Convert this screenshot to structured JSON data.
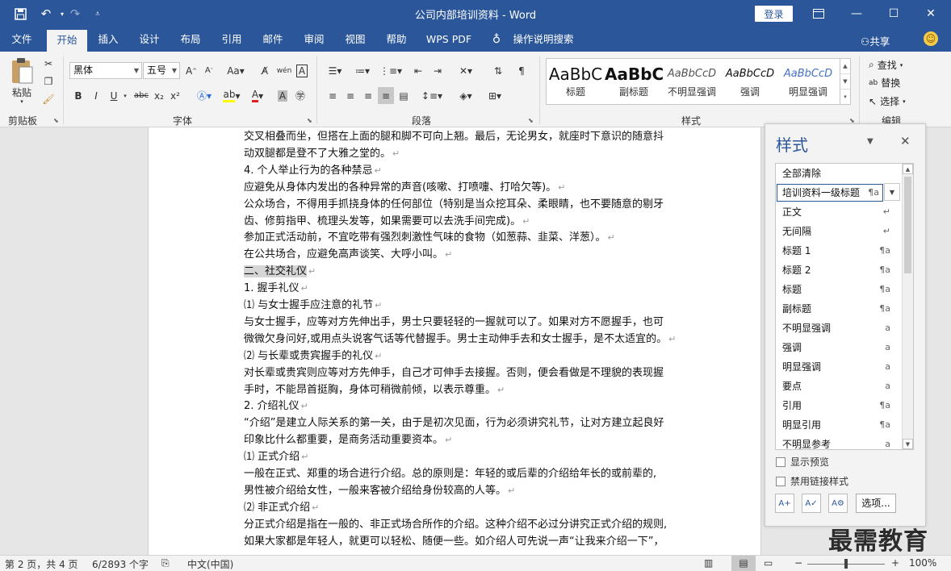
{
  "app": {
    "window_title": "公司内部培训资料  -  Word",
    "login_label": "登录",
    "quick_access": {
      "save": "save-icon",
      "undo": "undo-icon",
      "redo": "redo-icon",
      "customize": "customize-icon"
    },
    "window_controls": {
      "ribbon_display": "ribbon-display-icon",
      "minimize": "—",
      "maximize": "☐",
      "close": "✕"
    }
  },
  "tabs": [
    "文件",
    "开始",
    "插入",
    "设计",
    "布局",
    "引用",
    "邮件",
    "审阅",
    "视图",
    "帮助",
    "WPS PDF",
    "操作说明搜索"
  ],
  "active_tab": "开始",
  "share_label": "共享",
  "ribbon": {
    "clipboard": {
      "paste": "粘贴",
      "label": "剪贴板"
    },
    "font": {
      "name": "黑体",
      "size": "五号",
      "label": "字体",
      "buttons": [
        "B",
        "I",
        "U",
        "abc",
        "x₂",
        "x²"
      ]
    },
    "paragraph": {
      "label": "段落"
    },
    "styles": {
      "label": "样式",
      "gallery": [
        {
          "sample": "AaBbC",
          "name": "标题"
        },
        {
          "sample": "AaBbC",
          "name": "副标题"
        },
        {
          "sample": "AaBbCcD",
          "name": "不明显强调"
        },
        {
          "sample": "AaBbCcD",
          "name": "强调"
        },
        {
          "sample": "AaBbCcD",
          "name": "明显强调"
        }
      ]
    },
    "editing": {
      "find": "查找",
      "replace": "替换",
      "select": "选择",
      "label": "编辑"
    }
  },
  "document": {
    "lines": [
      {
        "text": "交叉相叠而坐，但搭在上面的腿和脚不可向上翘。最后，无论男女，就座时下意识的随意抖",
        "pm": ""
      },
      {
        "text": "动双腿都是登不了大雅之堂的。",
        "pm": "↵"
      },
      {
        "text": "4. 个人举止行为的各种禁忌",
        "pm": "↵"
      },
      {
        "text": "应避免从身体内发出的各种异常的声音(咳嗽、打喷嚏、打哈欠等)。",
        "pm": "↵"
      },
      {
        "text": "公众场合，不得用手抓挠身体的任何部位（特别是当众挖耳朵、柔眼睛，也不要随意的剔牙",
        "pm": ""
      },
      {
        "text": "齿、修剪指甲、梳理头发等，如果需要可以去洗手间完成)。",
        "pm": "↵"
      },
      {
        "text": "参加正式活动前，不宜吃带有强烈刺激性气味的食物（如葱蒜、韭菜、洋葱）。",
        "pm": "↵"
      },
      {
        "text": "在公共场合，应避免高声谈笑、大呼小叫。",
        "pm": "↵"
      },
      {
        "text": "二、社交礼仪",
        "pm": "↵",
        "highlight": true
      },
      {
        "text": "1. 握手礼仪",
        "pm": "↵"
      },
      {
        "text": "⑴ 与女士握手应注意的礼节",
        "pm": "↵"
      },
      {
        "text": "与女士握手，应等对方先伸出手，男士只要轻轻的一握就可以了。如果对方不愿握手，也可",
        "pm": ""
      },
      {
        "text": "微微欠身问好,或用点头说客气话等代替握手。男士主动伸手去和女士握手，是不太适宜的。",
        "pm": "↵"
      },
      {
        "text": "⑵ 与长辈或贵宾握手的礼仪",
        "pm": "↵"
      },
      {
        "text": "对长辈或贵宾则应等对方先伸手，自己才可伸手去接握。否则，便会看做是不理貌的表现握",
        "pm": ""
      },
      {
        "text": "手时，不能昂首挺胸，身体可稍微前倾，以表示尊重。",
        "pm": "↵"
      },
      {
        "text": "2. 介绍礼仪",
        "pm": "↵"
      },
      {
        "text": "“介绍”是建立人际关系的第一关，由于是初次见面，行为必须讲究礼节，让对方建立起良好",
        "pm": ""
      },
      {
        "text": "印象比什么都重要，是商务活动重要资本。",
        "pm": "↵"
      },
      {
        "text": "⑴ 正式介绍",
        "pm": "↵"
      },
      {
        "text": "一般在正式、郑重的场合进行介绍。总的原则是：年轻的或后辈的介绍给年长的或前辈的,",
        "pm": ""
      },
      {
        "text": "男性被介绍给女性，一般来客被介绍给身份较高的人等。",
        "pm": "↵"
      },
      {
        "text": "⑵ 非正式介绍",
        "pm": "↵"
      },
      {
        "text": "分正式介绍是指在一般的、非正式场合所作的介绍。这种介绍不必过分讲究正式介绍的规则,",
        "pm": ""
      },
      {
        "text": "如果大家都是年轻人，就更可以轻松、随便一些。如介绍人可先说一声“让我来介绍一下”，",
        "pm": ""
      }
    ]
  },
  "styles_pane": {
    "title": "样式",
    "items": [
      {
        "name": "全部清除",
        "sym": ""
      },
      {
        "name": "培训资料一级标题",
        "sym": "¶a",
        "selected": true
      },
      {
        "name": "正文",
        "sym": "↵"
      },
      {
        "name": "无间隔",
        "sym": "↵"
      },
      {
        "name": "标题 1",
        "sym": "¶a"
      },
      {
        "name": "标题 2",
        "sym": "¶a"
      },
      {
        "name": "标题",
        "sym": "¶a"
      },
      {
        "name": "副标题",
        "sym": "¶a"
      },
      {
        "name": "不明显强调",
        "sym": "a"
      },
      {
        "name": "强调",
        "sym": "a"
      },
      {
        "name": "明显强调",
        "sym": "a"
      },
      {
        "name": "要点",
        "sym": "a"
      },
      {
        "name": "引用",
        "sym": "¶a"
      },
      {
        "name": "明显引用",
        "sym": "¶a"
      },
      {
        "name": "不明显参考",
        "sym": "a"
      }
    ],
    "show_preview": "显示预览",
    "disable_linked": "禁用链接样式",
    "options_button": "选项..."
  },
  "watermark": "最需教育",
  "status_bar": {
    "page": "第 2 页，共 4 页",
    "words": "6/2893 个字",
    "language": "中文(中国)",
    "zoom": "100%",
    "zoom_fraction": 0.5
  },
  "colors": {
    "accent": "#2b579a",
    "font_color": "#e02020",
    "highlight": "#ffff00"
  }
}
